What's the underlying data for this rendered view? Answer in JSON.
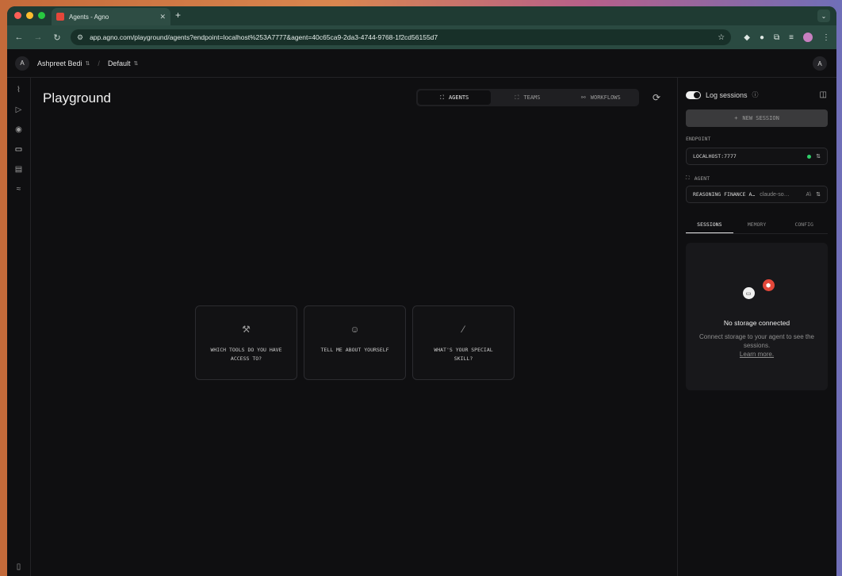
{
  "browser": {
    "tab_title": "Agents - Agno",
    "url": "app.agno.com/playground/agents?endpoint=localhost%253A7777&agent=40c65ca9-2da3-4744-9768-1f2cd56155d7",
    "colors": {
      "close": "#ff5f57",
      "minimize": "#febc2e",
      "maximize": "#28c840"
    }
  },
  "header": {
    "user_initial": "A",
    "user_name": "Ashpreet Bedi",
    "workspace": "Default",
    "separator": "/",
    "right_avatar": "A"
  },
  "main": {
    "title": "Playground",
    "tabs": [
      {
        "label": "AGENTS",
        "icon": "agent-icon"
      },
      {
        "label": "TEAMS",
        "icon": "teams-icon"
      },
      {
        "label": "WORKFLOWS",
        "icon": "workflows-icon"
      }
    ],
    "suggestions": [
      {
        "label": "WHICH TOOLS DO YOU HAVE ACCESS TO?",
        "icon": "hammer-icon"
      },
      {
        "label": "TELL ME ABOUT YOURSELF",
        "icon": "smile-icon"
      },
      {
        "label": "WHAT'S YOUR SPECIAL SKILL?",
        "icon": "wand-icon"
      }
    ]
  },
  "side": {
    "log_sessions": "Log sessions",
    "new_session": "NEW SESSION",
    "endpoint_label": "ENDPOINT",
    "endpoint_value": "LOCALHOST:7777",
    "agent_label": "AGENT",
    "agent_value": "REASONING FINANCE A…",
    "agent_model": "claude-so…",
    "agent_extra": "A\\",
    "tabs": [
      "SESSIONS",
      "MEMORY",
      "CONFIG"
    ],
    "storage_title": "No storage connected",
    "storage_desc": "Connect storage to your agent to see the sessions.",
    "storage_link": "Learn more."
  }
}
